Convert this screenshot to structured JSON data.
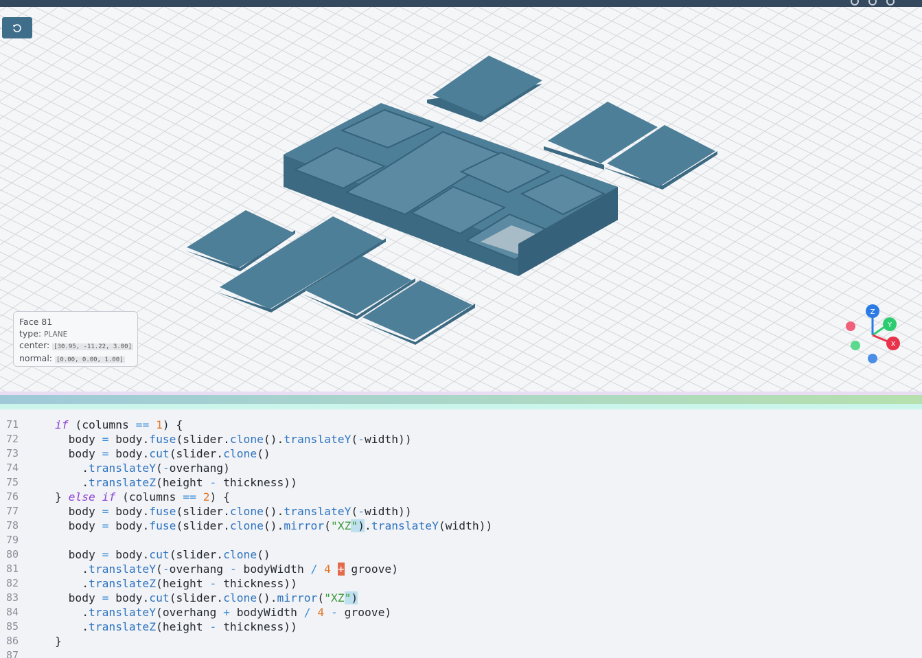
{
  "toolbar": {
    "reset_view_icon": "rotate-ccw-icon"
  },
  "face_info": {
    "title_label": "Face",
    "title_value": "81",
    "type_label": "type:",
    "type_value": "PLANE",
    "center_label": "center:",
    "center_value": "[30.95, -11.22, 3.00]",
    "normal_label": "normal:",
    "normal_value": "[0.00, 0.00, 1.00]"
  },
  "axes": {
    "z": "Z",
    "y": "Y",
    "x": "X"
  },
  "colors": {
    "part": "#4e7f98",
    "accent_bar": "#34495e",
    "button": "#3e6e8a"
  },
  "code": {
    "numbers": [
      "71",
      "72",
      "73",
      "74",
      "75",
      "76",
      "77",
      "78",
      "79",
      "80",
      "81",
      "82",
      "83",
      "84",
      "85",
      "86",
      "87"
    ]
  }
}
